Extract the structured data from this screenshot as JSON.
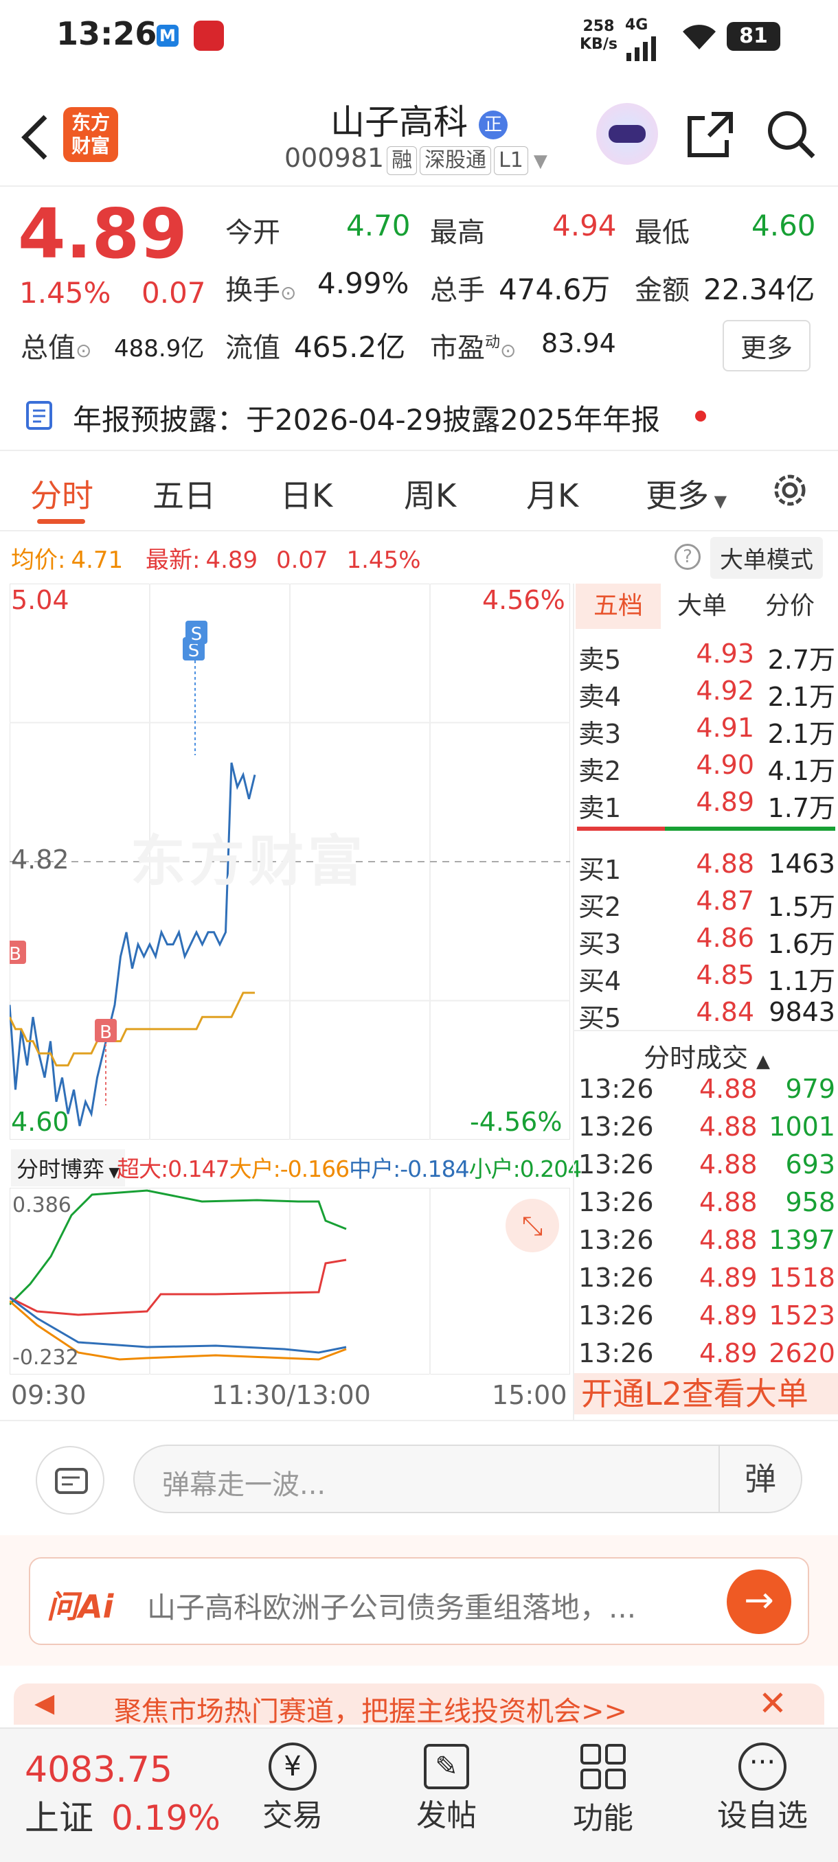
{
  "status": {
    "time": "13:26",
    "speed_top": "258",
    "speed_bottom": "KB/s",
    "net": "4G",
    "battery": "81"
  },
  "header": {
    "stock_name": "山子高科",
    "stock_code": "000981",
    "badges": [
      "融",
      "深股通",
      "L1"
    ],
    "logo_line1": "东方",
    "logo_line2": "财富"
  },
  "quote": {
    "price": "4.89",
    "change_pct": "1.45%",
    "change": "0.07",
    "open_label": "今开",
    "open": "4.70",
    "high_label": "最高",
    "high": "4.94",
    "low_label": "最低",
    "low": "4.60",
    "turnover_label": "换手",
    "turnover": "4.99%",
    "volume_label": "总手",
    "volume": "474.6万",
    "amount_label": "金额",
    "amount": "22.34亿",
    "mktcap_label": "总值",
    "mktcap": "488.9亿",
    "float_label": "流值",
    "float": "465.2亿",
    "pe_label": "市盈",
    "pe_sup": "动",
    "pe": "83.94",
    "more": "更多"
  },
  "notice": {
    "text": "年报预披露：于2026-04-29披露2025年年报"
  },
  "tabs": [
    "分时",
    "五日",
    "日K",
    "周K",
    "月K",
    "更多"
  ],
  "info_line": {
    "avg_label": "均价:",
    "avg": "4.71",
    "latest_label": "最新:",
    "latest": "4.89",
    "chg": "0.07",
    "pct": "1.45%",
    "mode": "大单模式"
  },
  "chart_data": {
    "type": "line",
    "ylim": [
      4.6,
      5.04
    ],
    "y_ticks_left": [
      "5.04",
      "4.82",
      "4.60"
    ],
    "y_ticks_right": [
      "4.56%",
      "-4.56%"
    ],
    "x_ticks": [
      "09:30",
      "11:30/13:00",
      "15:00"
    ],
    "watermark": "东方财富",
    "markers": [
      "B",
      "B",
      "S",
      "S"
    ],
    "series": [
      {
        "color": "#2f6fb8",
        "values": [
          4.7,
          4.63,
          4.68,
          4.65,
          4.69,
          4.66,
          4.64,
          4.67,
          4.62,
          4.64,
          4.61,
          4.63,
          4.6,
          4.62,
          4.61,
          4.64,
          4.66,
          4.68,
          4.7,
          4.74,
          4.76,
          4.73,
          4.75,
          4.74,
          4.75,
          4.74,
          4.76,
          4.75,
          4.75,
          4.76,
          4.74,
          4.75,
          4.76,
          4.75,
          4.76,
          4.76,
          4.75,
          4.76,
          4.9,
          4.88,
          4.89,
          4.87,
          4.89
        ]
      },
      {
        "color": "#e0a020",
        "values": [
          4.69,
          4.68,
          4.68,
          4.67,
          4.67,
          4.66,
          4.66,
          4.66,
          4.65,
          4.65,
          4.65,
          4.66,
          4.66,
          4.66,
          4.66,
          4.67,
          4.67,
          4.67,
          4.67,
          4.67,
          4.68,
          4.68,
          4.68,
          4.68,
          4.68,
          4.68,
          4.68,
          4.68,
          4.68,
          4.68,
          4.68,
          4.68,
          4.68,
          4.69,
          4.69,
          4.69,
          4.69,
          4.69,
          4.69,
          4.7,
          4.71,
          4.71,
          4.71
        ]
      }
    ],
    "sub": {
      "label": "分时博弈",
      "legend": [
        {
          "name": "超大",
          "value": "0.147",
          "color": "#e33b3b"
        },
        {
          "name": "大户",
          "value": "-0.166",
          "color": "#f08a00"
        },
        {
          "name": "中户",
          "value": "-0.184",
          "color": "#2f6fb8"
        },
        {
          "name": "小户",
          "value": "0.204",
          "color": "#17a034"
        }
      ],
      "y_top": "0.386",
      "y_bottom": "-0.232",
      "ylim": [
        -0.232,
        0.386
      ]
    }
  },
  "book": {
    "tabs": [
      "五档",
      "大单",
      "分价"
    ],
    "asks": [
      {
        "label": "卖5",
        "price": "4.93",
        "vol": "2.7万"
      },
      {
        "label": "卖4",
        "price": "4.92",
        "vol": "2.1万"
      },
      {
        "label": "卖3",
        "price": "4.91",
        "vol": "2.1万"
      },
      {
        "label": "卖2",
        "price": "4.90",
        "vol": "4.1万"
      },
      {
        "label": "卖1",
        "price": "4.89",
        "vol": "1.7万"
      }
    ],
    "bids": [
      {
        "label": "买1",
        "price": "4.88",
        "vol": "1463"
      },
      {
        "label": "买2",
        "price": "4.87",
        "vol": "1.5万"
      },
      {
        "label": "买3",
        "price": "4.86",
        "vol": "1.6万"
      },
      {
        "label": "买4",
        "price": "4.85",
        "vol": "1.1万"
      },
      {
        "label": "买5",
        "price": "4.84",
        "vol": "9843"
      }
    ],
    "ticks_title": "分时成交",
    "ticks": [
      {
        "time": "13:26",
        "price": "4.88",
        "vol": "979"
      },
      {
        "time": "13:26",
        "price": "4.88",
        "vol": "1001"
      },
      {
        "time": "13:26",
        "price": "4.88",
        "vol": "693"
      },
      {
        "time": "13:26",
        "price": "4.88",
        "vol": "958"
      },
      {
        "time": "13:26",
        "price": "4.88",
        "vol": "1397"
      },
      {
        "time": "13:26",
        "price": "4.89",
        "vol": "1518"
      },
      {
        "time": "13:26",
        "price": "4.89",
        "vol": "1523"
      },
      {
        "time": "13:26",
        "price": "4.89",
        "vol": "2620"
      }
    ],
    "l2_banner": "开通L2查看大单"
  },
  "danmaku": {
    "placeholder": "弹幕走一波...",
    "btn": "弹"
  },
  "ai": {
    "logo": "问Ai",
    "text": "山子高科欧洲子公司债务重组落地，..."
  },
  "promo": {
    "text": "聚焦市场热门赛道，把握主线投资机会>>"
  },
  "bottom": {
    "index_value": "4083.75",
    "index_name": "上证",
    "index_pct": "0.19%",
    "items": [
      "交易",
      "发帖",
      "功能",
      "设自选"
    ]
  }
}
